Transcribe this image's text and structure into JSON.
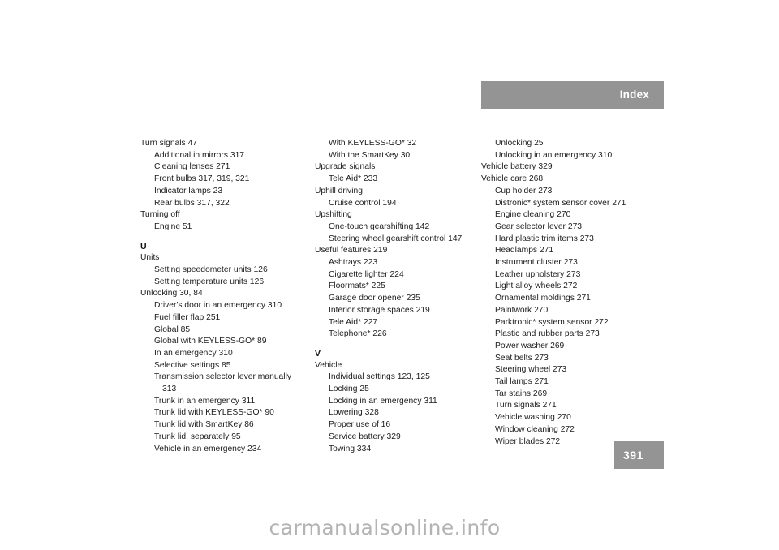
{
  "header": {
    "title": "Index"
  },
  "footer": {
    "page_number": "391",
    "watermark": "carmanualsonline.info"
  },
  "colors": {
    "accent_gray": "#949494",
    "text": "#1c1c1c",
    "watermark": "#b3b3b3",
    "page_background": "#ffffff"
  },
  "columns": [
    {
      "id": "column-1",
      "entries": [
        {
          "text": "Turn signals 47",
          "level": 0
        },
        {
          "text": "Additional in mirrors 317",
          "level": 1
        },
        {
          "text": "Cleaning lenses 271",
          "level": 1
        },
        {
          "text": "Front bulbs 317, 319, 321",
          "level": 1
        },
        {
          "text": "Indicator lamps 23",
          "level": 1
        },
        {
          "text": "Rear bulbs 317, 322",
          "level": 1
        },
        {
          "text": "Turning off",
          "level": 0
        },
        {
          "text": "Engine 51",
          "level": 1
        },
        {
          "text": "U",
          "level": 0,
          "type": "section"
        },
        {
          "text": "Units",
          "level": 0
        },
        {
          "text": "Setting speedometer units 126",
          "level": 1
        },
        {
          "text": "Setting temperature units 126",
          "level": 1
        },
        {
          "text": "Unlocking 30, 84",
          "level": 0
        },
        {
          "text": "Driver's door in an emergency 310",
          "level": 1
        },
        {
          "text": "Fuel filler flap 251",
          "level": 1
        },
        {
          "text": "Global 85",
          "level": 1
        },
        {
          "text": "Global with KEYLESS-GO* 89",
          "level": 1
        },
        {
          "text": "In an emergency 310",
          "level": 1
        },
        {
          "text": "Selective settings 85",
          "level": 1
        },
        {
          "text": "Transmission selector lever manually",
          "level": 1
        },
        {
          "text": "313",
          "level": 2
        },
        {
          "text": "Trunk in an emergency 311",
          "level": 1
        },
        {
          "text": "Trunk lid with KEYLESS-GO* 90",
          "level": 1
        },
        {
          "text": "Trunk lid with SmartKey 86",
          "level": 1
        },
        {
          "text": "Trunk lid, separately 95",
          "level": 1
        },
        {
          "text": "Vehicle in an emergency 234",
          "level": 1
        }
      ]
    },
    {
      "id": "column-2",
      "entries": [
        {
          "text": "With KEYLESS-GO* 32",
          "level": 1
        },
        {
          "text": "With the SmartKey 30",
          "level": 1
        },
        {
          "text": "Upgrade signals",
          "level": 0
        },
        {
          "text": "Tele Aid* 233",
          "level": 1
        },
        {
          "text": "Uphill driving",
          "level": 0
        },
        {
          "text": "Cruise control 194",
          "level": 1
        },
        {
          "text": "Upshifting",
          "level": 0
        },
        {
          "text": "One-touch gearshifting 142",
          "level": 1
        },
        {
          "text": "Steering wheel gearshift control 147",
          "level": 1
        },
        {
          "text": "Useful features 219",
          "level": 0
        },
        {
          "text": "Ashtrays 223",
          "level": 1
        },
        {
          "text": "Cigarette lighter 224",
          "level": 1
        },
        {
          "text": "Floormats* 225",
          "level": 1
        },
        {
          "text": "Garage door opener 235",
          "level": 1
        },
        {
          "text": "Interior storage spaces 219",
          "level": 1
        },
        {
          "text": "Tele Aid* 227",
          "level": 1
        },
        {
          "text": "Telephone* 226",
          "level": 1
        },
        {
          "text": "V",
          "level": 0,
          "type": "section"
        },
        {
          "text": "Vehicle",
          "level": 0
        },
        {
          "text": "Individual settings 123, 125",
          "level": 1
        },
        {
          "text": "Locking 25",
          "level": 1
        },
        {
          "text": "Locking in an emergency 311",
          "level": 1
        },
        {
          "text": "Lowering 328",
          "level": 1
        },
        {
          "text": "Proper use of 16",
          "level": 1
        },
        {
          "text": "Service battery 329",
          "level": 1
        },
        {
          "text": "Towing 334",
          "level": 1
        }
      ]
    },
    {
      "id": "column-3",
      "entries": [
        {
          "text": "Unlocking 25",
          "level": 1
        },
        {
          "text": "Unlocking in an emergency 310",
          "level": 1
        },
        {
          "text": "Vehicle battery 329",
          "level": 0
        },
        {
          "text": "Vehicle care 268",
          "level": 0
        },
        {
          "text": "Cup holder 273",
          "level": 1
        },
        {
          "text": "Distronic* system sensor cover 271",
          "level": 1
        },
        {
          "text": "Engine cleaning 270",
          "level": 1
        },
        {
          "text": "Gear selector lever 273",
          "level": 1
        },
        {
          "text": "Hard plastic trim items 273",
          "level": 1
        },
        {
          "text": "Headlamps 271",
          "level": 1
        },
        {
          "text": "Instrument cluster 273",
          "level": 1
        },
        {
          "text": "Leather upholstery 273",
          "level": 1
        },
        {
          "text": "Light alloy wheels 272",
          "level": 1
        },
        {
          "text": "Ornamental moldings 271",
          "level": 1
        },
        {
          "text": "Paintwork 270",
          "level": 1
        },
        {
          "text": "Parktronic* system sensor 272",
          "level": 1
        },
        {
          "text": "Plastic and rubber parts 273",
          "level": 1
        },
        {
          "text": "Power washer 269",
          "level": 1
        },
        {
          "text": "Seat belts 273",
          "level": 1
        },
        {
          "text": "Steering wheel 273",
          "level": 1
        },
        {
          "text": "Tail lamps 271",
          "level": 1
        },
        {
          "text": "Tar stains 269",
          "level": 1
        },
        {
          "text": "Turn signals 271",
          "level": 1
        },
        {
          "text": "Vehicle washing 270",
          "level": 1
        },
        {
          "text": "Window cleaning 272",
          "level": 1
        },
        {
          "text": "Wiper blades 272",
          "level": 1
        }
      ]
    }
  ]
}
